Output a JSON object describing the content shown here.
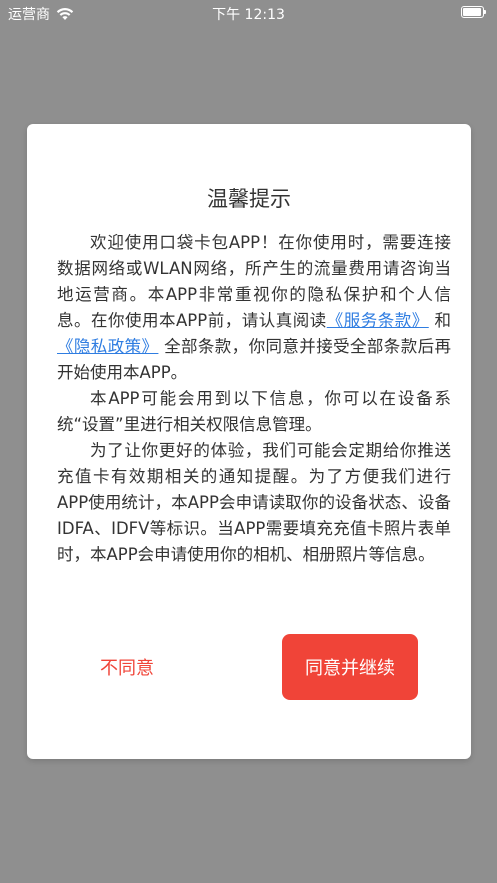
{
  "status_bar": {
    "carrier": "运营商",
    "time": "下午 12:13",
    "wifi_icon": "wifi-icon",
    "battery_icon": "battery-icon"
  },
  "dialog": {
    "title": "温馨提示",
    "paragraph1": {
      "text_before": "欢迎使用口袋卡包APP！在你使用时，需要连接数据网络或WLAN网络，所产生的流量费用请咨询当地运营商。本APP非常重视你的隐私保护和个人信息。在你使用本APP前，请认真阅读",
      "link_terms": "《服务条款》",
      "text_and": " 和",
      "link_privacy": "《隐私政策》",
      "text_after": " 全部条款，你同意并接受全部条款后再开始使用本APP。"
    },
    "paragraph2": "本APP可能会用到以下信息，你可以在设备系统“设置”里进行相关权限信息管理。",
    "paragraph3": "为了让你更好的体验，我们可能会定期给你推送充值卡有效期相关的通知提醒。为了方便我们进行APP使用统计，本APP会申请读取你的设备状态、设备IDFA、IDFV等标识。当APP需要填充充值卡照片表单时，本APP会申请使用你的相机、相册照片等信息。",
    "disagree_label": "不同意",
    "agree_label": "同意并继续",
    "colors": {
      "accent": "#f04438",
      "link": "#2f7de1",
      "overlay": "#8f8f8f"
    }
  }
}
